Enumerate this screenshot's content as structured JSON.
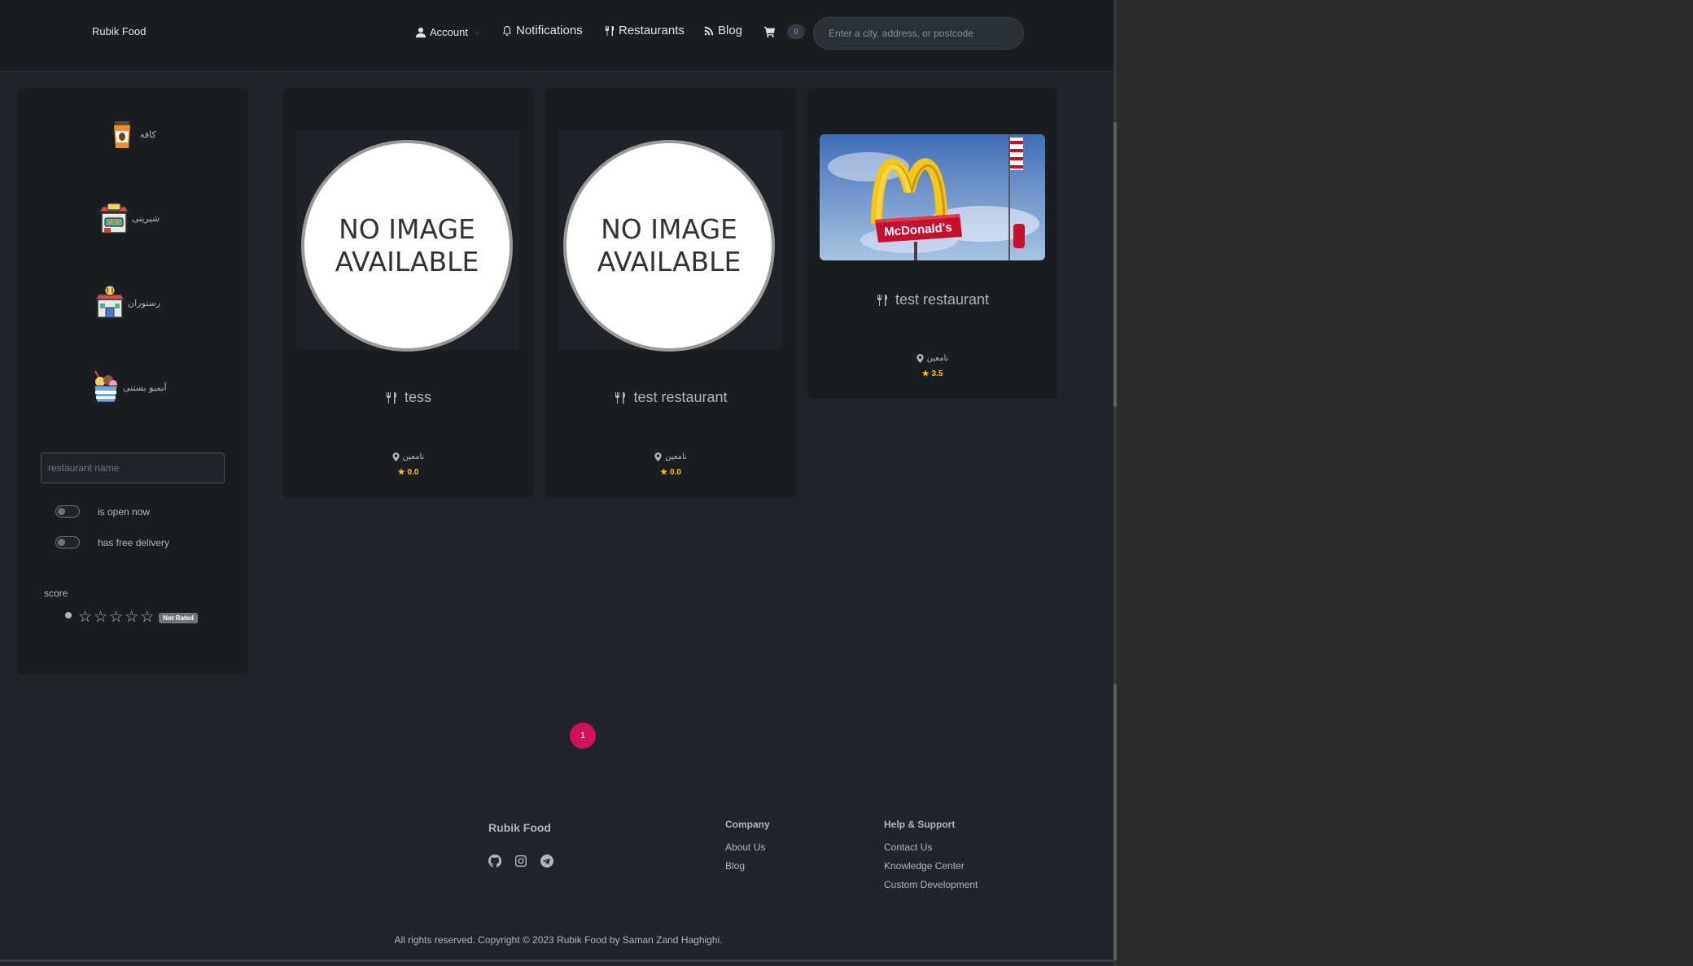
{
  "navbar": {
    "brand": "Rubik Food",
    "account": "Account",
    "notifications": "Notifications",
    "restaurants": "Restaurants",
    "blog": "Blog",
    "cart_count": "0",
    "search_placeholder": "Enter a city, address, or postcode"
  },
  "sidebar": {
    "categories": [
      {
        "label": "کافه",
        "icon": "coffee-cup-icon"
      },
      {
        "label": "شیرینی",
        "icon": "pastry-shop-icon"
      },
      {
        "label": "رستوران",
        "icon": "restaurant-building-icon"
      },
      {
        "label": "آبمیو بستنی",
        "icon": "ice-cream-icon"
      }
    ],
    "name_placeholder": "restaurant name",
    "is_open_label": "is open now",
    "free_delivery_label": "has free delivery",
    "score_label": "score",
    "not_rated": "Not Rated"
  },
  "cards": [
    {
      "title": "tess",
      "location": "نامعین",
      "rating": "0.0",
      "image_text": [
        "NO IMAGE",
        "AVAILABLE"
      ]
    },
    {
      "title": "test restaurant",
      "location": "نامعین",
      "rating": "0.0",
      "image_text": [
        "NO IMAGE",
        "AVAILABLE"
      ]
    },
    {
      "title": "test restaurant",
      "location": "نامعین",
      "rating": "3.5",
      "image_sign": "McDonald's"
    }
  ],
  "pagination": {
    "current": "1"
  },
  "footer": {
    "brand": "Rubik Food",
    "company": {
      "title": "Company",
      "links": [
        "About Us",
        "Blog"
      ]
    },
    "help": {
      "title": "Help & Support",
      "links": [
        "Contact Us",
        "Knowledge Center",
        "Custom Development"
      ]
    },
    "copyright": "All rights reserved. Copyright © 2023 Rubik Food by Saman Zand Haghighi."
  },
  "colors": {
    "background": "#212529",
    "panel": "#1b1e21",
    "accent_pink": "#d1105a",
    "star": "#ffc107"
  }
}
